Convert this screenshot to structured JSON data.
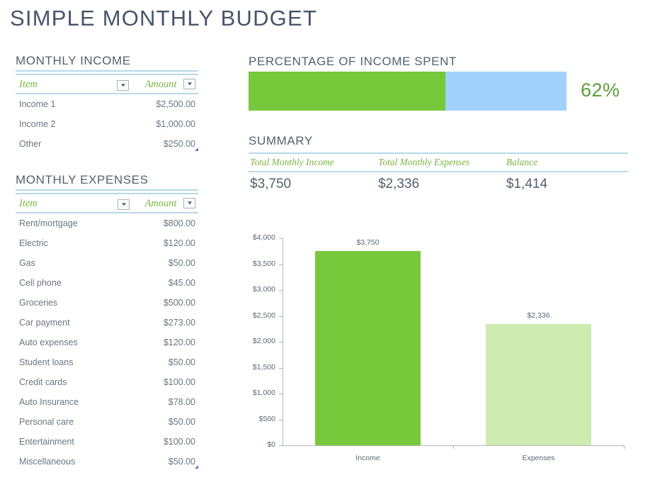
{
  "title": "SIMPLE MONTHLY BUDGET",
  "colors": {
    "title": "#49546a",
    "accent_green": "#78c83c",
    "light_green": "#cdeab0",
    "light_blue": "#a2d2fc",
    "rule_blue": "#b9d9e9",
    "header_green": "#7cb342",
    "pct_label_green": "#5d9e38"
  },
  "income": {
    "heading": "MONTHLY INCOME",
    "columns": [
      "Item",
      "Amount"
    ],
    "filter_icon": "chevron-down-icon",
    "rows": [
      {
        "item": "Income 1",
        "amount": "$2,500.00"
      },
      {
        "item": "Income 2",
        "amount": "$1,000.00"
      },
      {
        "item": "Other",
        "amount": "$250.00"
      }
    ]
  },
  "expenses": {
    "heading": "MONTHLY EXPENSES",
    "columns": [
      "Item",
      "Amount"
    ],
    "filter_icon": "chevron-down-icon",
    "rows": [
      {
        "item": "Rent/mortgage",
        "amount": "$800.00"
      },
      {
        "item": "Electric",
        "amount": "$120.00"
      },
      {
        "item": "Gas",
        "amount": "$50.00"
      },
      {
        "item": "Cell phone",
        "amount": "$45.00"
      },
      {
        "item": "Groceries",
        "amount": "$500.00"
      },
      {
        "item": "Car payment",
        "amount": "$273.00"
      },
      {
        "item": "Auto expenses",
        "amount": "$120.00"
      },
      {
        "item": "Student loans",
        "amount": "$50.00"
      },
      {
        "item": "Credit cards",
        "amount": "$100.00"
      },
      {
        "item": "Auto Insurance",
        "amount": "$78.00"
      },
      {
        "item": "Personal care",
        "amount": "$50.00"
      },
      {
        "item": "Entertainment",
        "amount": "$100.00"
      },
      {
        "item": "Miscellaneous",
        "amount": "$50.00"
      }
    ]
  },
  "percentage": {
    "heading": "PERCENTAGE OF INCOME SPENT",
    "value_label": "62%",
    "spent_pct": 62,
    "remaining_pct": 38
  },
  "summary": {
    "heading": "SUMMARY",
    "columns": [
      "Total Monthly Income",
      "Total Monthly Expenses",
      "Balance"
    ],
    "values": [
      "$3,750",
      "$2,336",
      "$1,414"
    ]
  },
  "chart_data": {
    "type": "bar",
    "title": "",
    "xlabel": "",
    "ylabel": "",
    "categories": [
      "Income",
      "Expenses"
    ],
    "values": [
      3750,
      2336
    ],
    "data_labels": [
      "$3,750",
      "$2,336"
    ],
    "bar_colors": [
      "#78c83c",
      "#cdeab0"
    ],
    "ylim": [
      0,
      4000
    ],
    "ytick_values": [
      0,
      500,
      1000,
      1500,
      2000,
      2500,
      3000,
      3500,
      4000
    ],
    "ytick_labels": [
      "$0",
      "$500",
      "$1,000",
      "$1,500",
      "$2,000",
      "$2,500",
      "$3,000",
      "$3,500",
      "$4,000"
    ],
    "grid": false,
    "legend": false
  }
}
